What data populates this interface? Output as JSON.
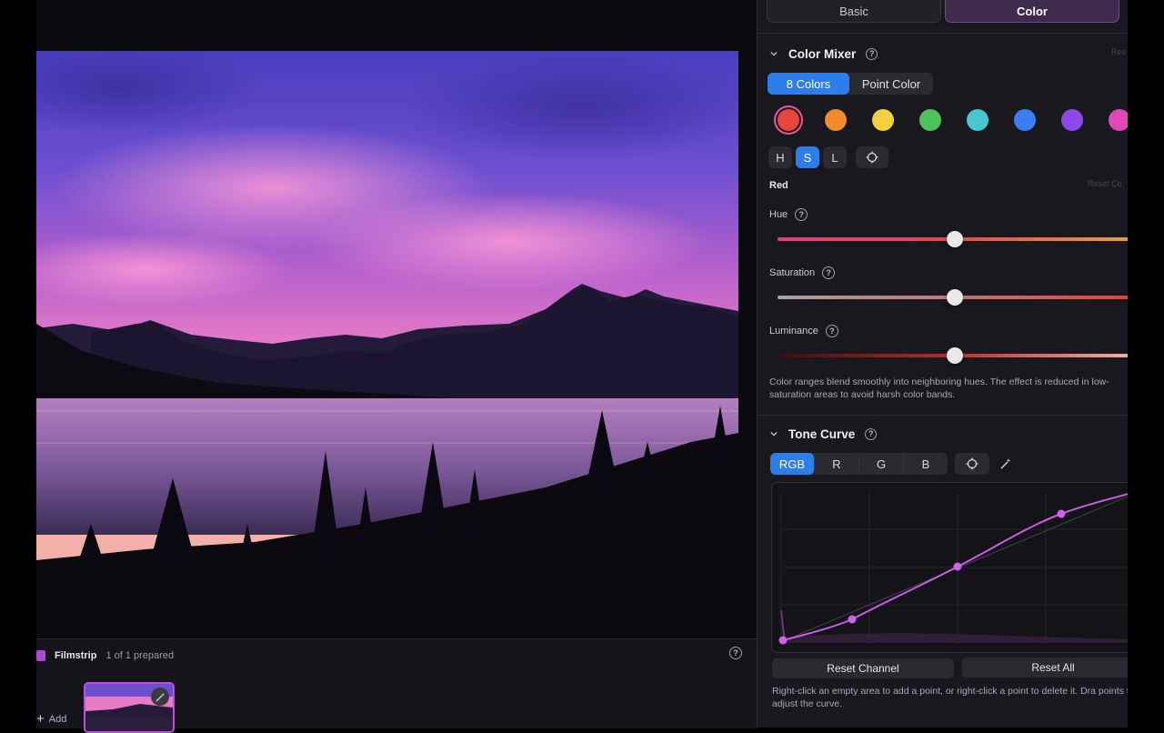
{
  "mode_tabs": [
    {
      "label": "Basic",
      "active": false
    },
    {
      "label": "Color",
      "active": true
    }
  ],
  "color_mixer": {
    "title": "Color Mixer",
    "reset": "Res",
    "modes": [
      {
        "label": "8 Colors",
        "active": true
      },
      {
        "label": "Point Color",
        "active": false
      }
    ],
    "swatches": [
      {
        "name": "red",
        "color": "#e8453c",
        "selected": true
      },
      {
        "name": "orange",
        "color": "#f28a30"
      },
      {
        "name": "yellow",
        "color": "#f2d040"
      },
      {
        "name": "green",
        "color": "#4cc35a"
      },
      {
        "name": "aqua",
        "color": "#4ac6d0"
      },
      {
        "name": "blue",
        "color": "#3a7ef0"
      },
      {
        "name": "purple",
        "color": "#8d48e8"
      },
      {
        "name": "magenta",
        "color": "#e048b8"
      }
    ],
    "hsl_buttons": [
      {
        "label": "H",
        "active": false
      },
      {
        "label": "S",
        "active": true
      },
      {
        "label": "L",
        "active": false
      }
    ],
    "current_color": "Red",
    "reset_color": "Reset Co",
    "sliders": [
      {
        "label": "Hue",
        "value": 0
      },
      {
        "label": "Saturation",
        "value": 0
      },
      {
        "label": "Luminance",
        "value": 0
      }
    ],
    "note": "Color ranges blend smoothly into neighboring hues. The effect is reduced in low-saturation areas to avoid harsh color bands."
  },
  "tone_curve": {
    "title": "Tone Curve",
    "channels": [
      {
        "label": "RGB",
        "active": true
      },
      {
        "label": "R",
        "active": false
      },
      {
        "label": "G",
        "active": false
      },
      {
        "label": "B",
        "active": false
      }
    ],
    "reset_channel": "Reset Channel",
    "reset_all": "Reset All",
    "hint": "Right-click an empty area to add a point, or right-click a point to delete it. Dra points to adjust the curve."
  },
  "filmstrip": {
    "title": "Filmstrip",
    "count": "1 of 1 prepared",
    "add_label": "Add"
  }
}
